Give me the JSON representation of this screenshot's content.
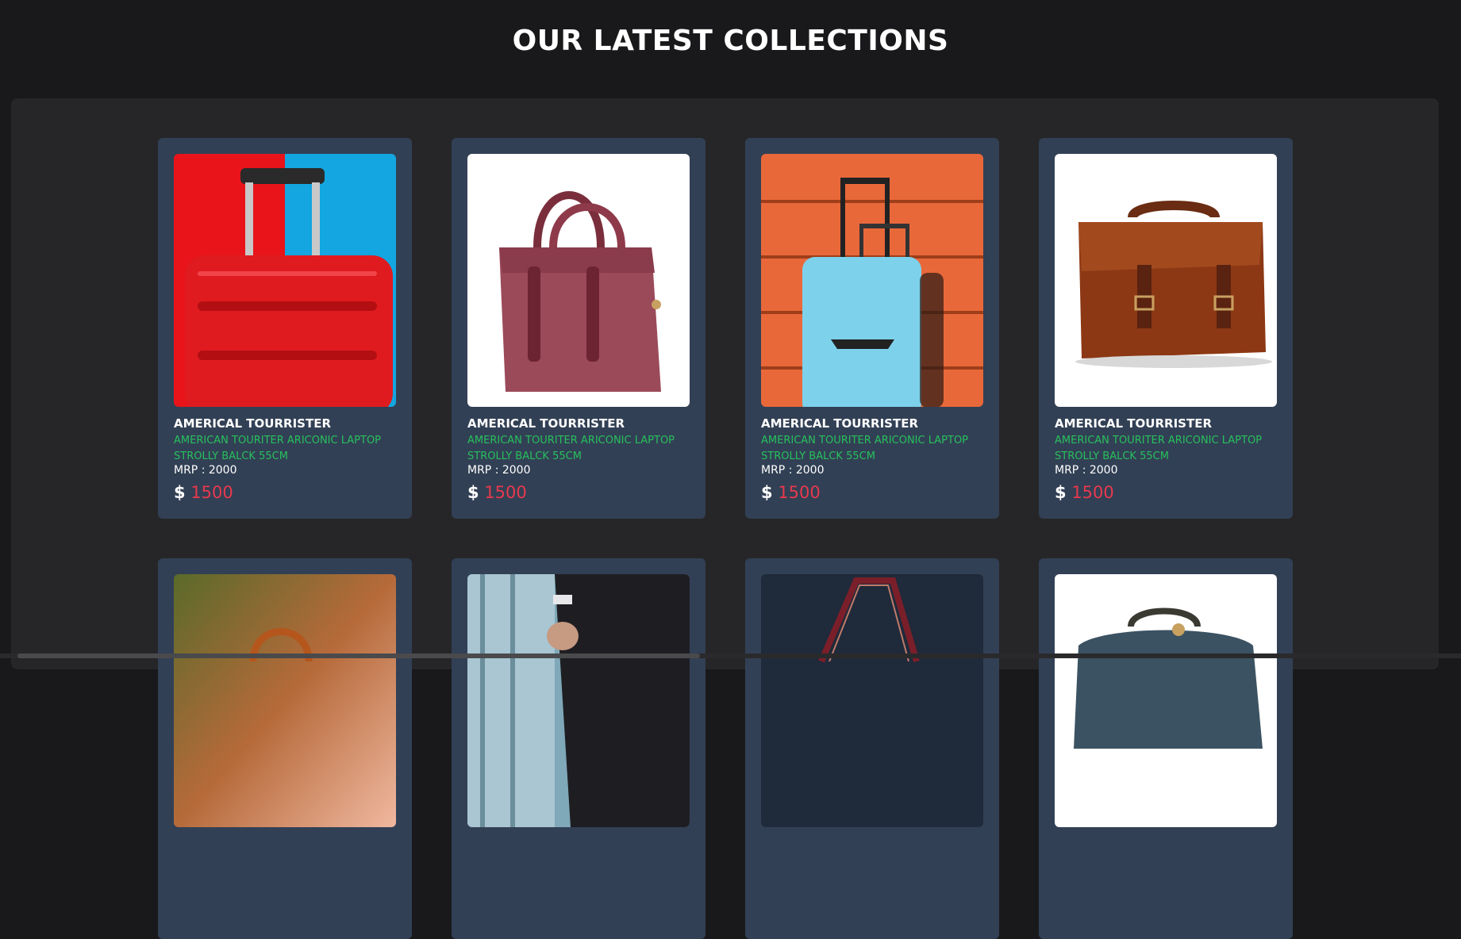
{
  "page": {
    "title": "OUR LATEST COLLECTIONS"
  },
  "products": [
    {
      "brand": "AMERICAL TOURRISTER",
      "description": "AMERICAN TOURITER ARICONIC LAPTOP STROLLY BALCK 55CM",
      "mrp": "MRP : 2000",
      "currency": "$",
      "price": "1500",
      "image": "red-suitcase-image"
    },
    {
      "brand": "AMERICAL TOURRISTER",
      "description": "AMERICAN TOURITER ARICONIC LAPTOP STROLLY BALCK 55CM",
      "mrp": "MRP : 2000",
      "currency": "$",
      "price": "1500",
      "image": "maroon-handbag-image"
    },
    {
      "brand": "AMERICAL TOURRISTER",
      "description": "AMERICAN TOURITER ARICONIC LAPTOP STROLLY BALCK 55CM",
      "mrp": "MRP : 2000",
      "currency": "$",
      "price": "1500",
      "image": "blue-suitcase-image"
    },
    {
      "brand": "AMERICAL TOURRISTER",
      "description": "AMERICAN TOURITER ARICONIC LAPTOP STROLLY BALCK 55CM",
      "mrp": "MRP : 2000",
      "currency": "$",
      "price": "1500",
      "image": "brown-leather-bag-image"
    },
    {
      "image": "tan-handbag-image"
    },
    {
      "image": "businessman-briefcase-image"
    },
    {
      "image": "dark-shoulder-bag-image"
    },
    {
      "image": "vintage-travel-bag-image"
    }
  ],
  "colors": {
    "background": "#19191b",
    "panel": "#262628",
    "card": "#324055",
    "description": "#27c05c",
    "price": "#e8394d"
  }
}
